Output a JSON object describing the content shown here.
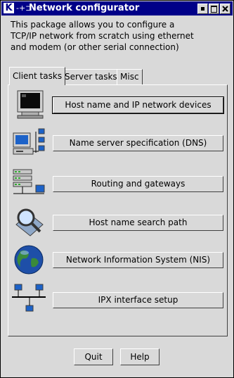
{
  "window": {
    "title": "Network configurator",
    "logo_letter": "K",
    "arrow_glyph": "-+⊐"
  },
  "description": {
    "lines": [
      "This package allows you to configure a",
      "TCP/IP network from scratch using ethernet",
      "and modem (or other serial connection)"
    ]
  },
  "tabs": [
    {
      "label": "Client tasks",
      "active": true
    },
    {
      "label": "Server tasks",
      "active": false
    },
    {
      "label": "Misc",
      "active": false
    }
  ],
  "tasks": [
    {
      "label": "Host name and IP network devices",
      "icon": "monitor-icon"
    },
    {
      "label": "Name server specification (DNS)",
      "icon": "computers-network-icon"
    },
    {
      "label": "Routing and gateways",
      "icon": "routers-icon"
    },
    {
      "label": "Host name search path",
      "icon": "magnifier-icon"
    },
    {
      "label": "Network Information System (NIS)",
      "icon": "globe-icon"
    },
    {
      "label": "IPX interface setup",
      "icon": "ipx-network-icon"
    }
  ],
  "buttons": {
    "quit": "Quit",
    "help": "Help"
  }
}
